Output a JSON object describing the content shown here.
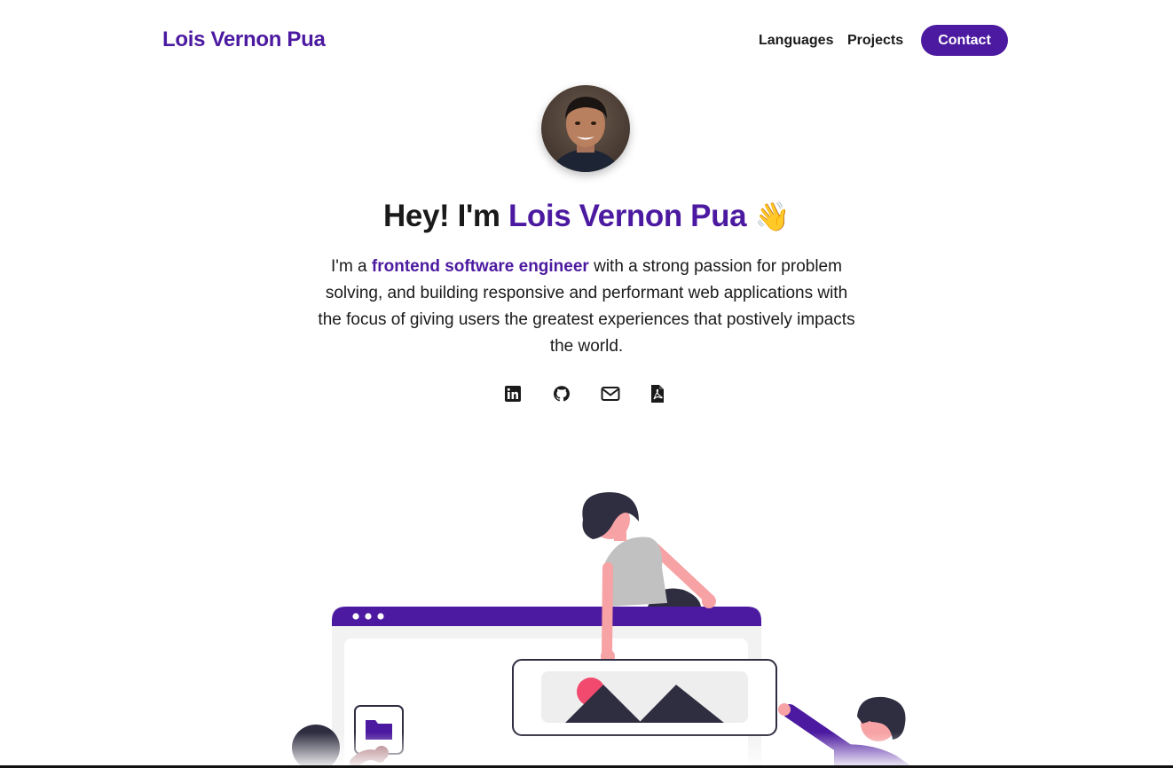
{
  "nav": {
    "brand": "Lois Vernon Pua",
    "links": [
      "Languages",
      "Projects"
    ],
    "contact": "Contact"
  },
  "hero": {
    "greeting": "Hey! I'm ",
    "name": "Lois Vernon Pua",
    "wave": "👋",
    "bio_before": "I'm a ",
    "bio_highlight": "frontend software engineer",
    "bio_after": " with a strong passion for problem solving, and building responsive and performant web applications with the focus of giving users the greatest experiences that postively impacts the world."
  },
  "socials": [
    {
      "icon": "linkedin-icon"
    },
    {
      "icon": "github-icon"
    },
    {
      "icon": "mail-icon"
    },
    {
      "icon": "pdf-resume-icon"
    }
  ],
  "colors": {
    "accent": "#4c1aa0",
    "text": "#1a1a1a",
    "skin": "#f7a2a4",
    "hair": "#2f2e41",
    "shirt": "#c1c1c1",
    "sun": "#f14a6e"
  }
}
